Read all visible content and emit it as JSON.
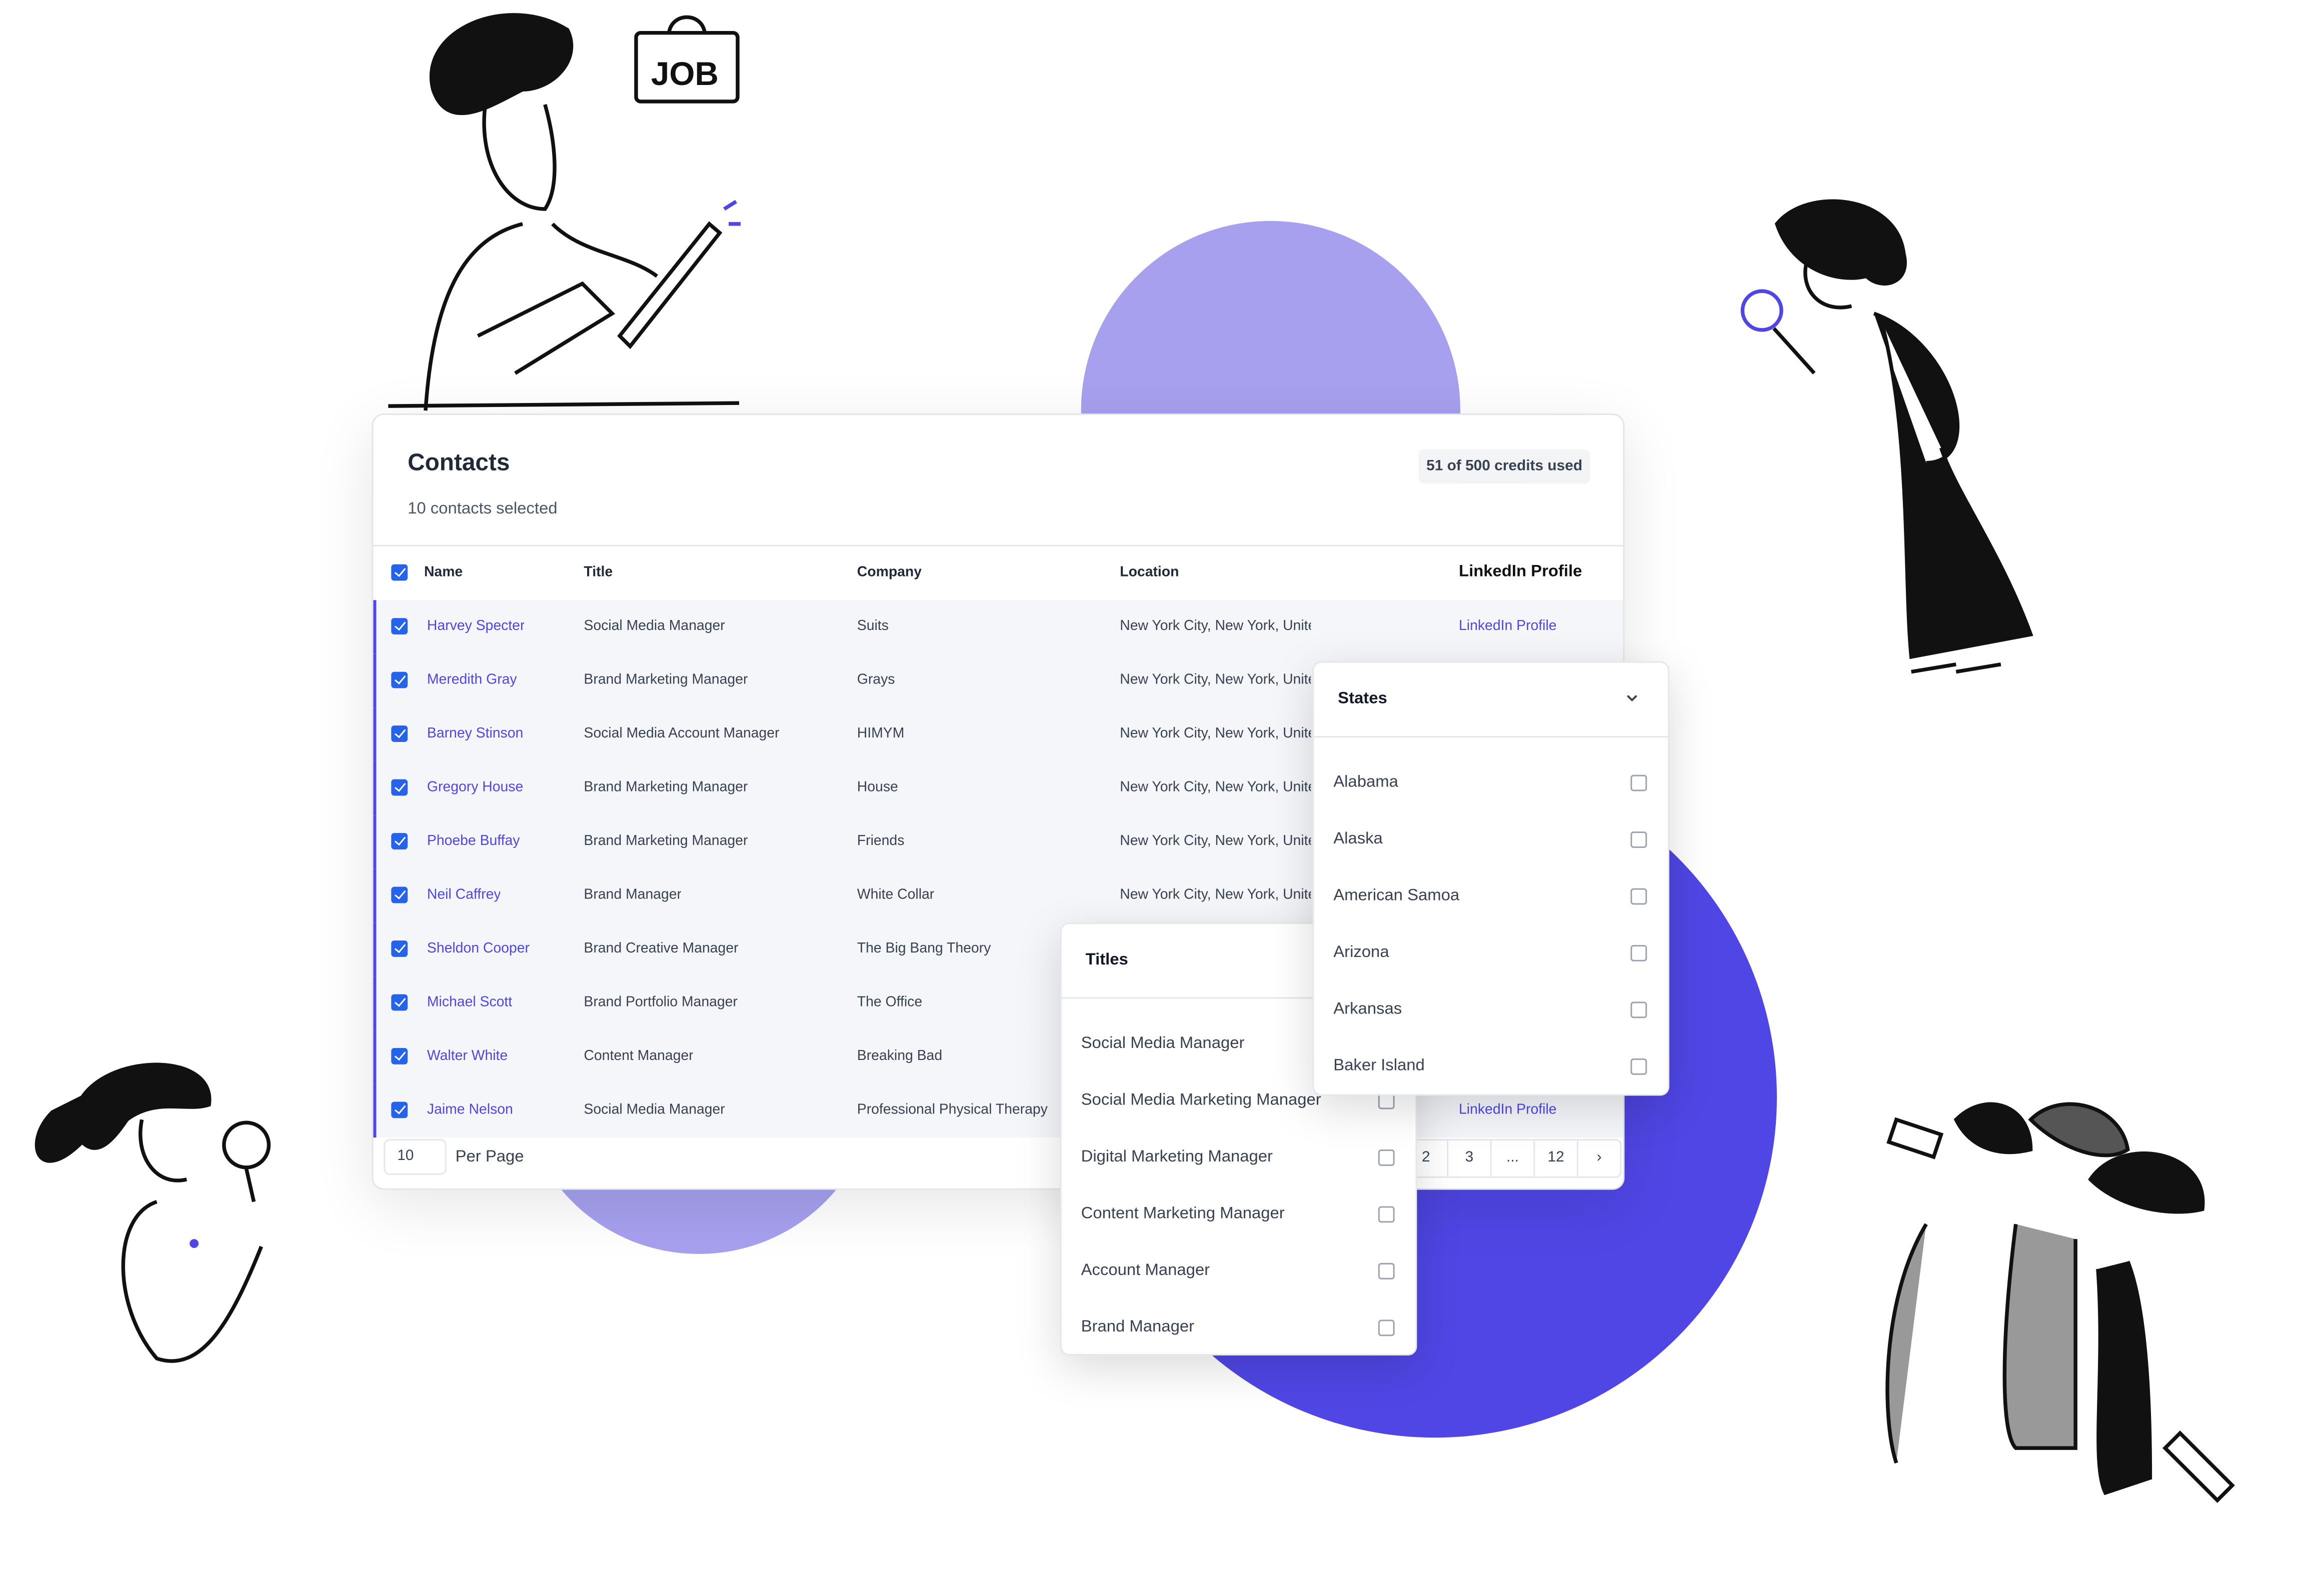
{
  "colors": {
    "accent": "#4f46e5",
    "accent_light": "#a6a0ef",
    "row_bg": "#f5f6fa"
  },
  "contacts": {
    "title": "Contacts",
    "subtitle": "10 contacts selected",
    "credits_badge": "51 of 500 credits used",
    "columns": [
      "Name",
      "Title",
      "Company",
      "Location",
      "LinkedIn Profile"
    ],
    "rows": [
      {
        "name": "Harvey Specter",
        "title": "Social Media Manager",
        "company": "Suits",
        "location": "New York City, New York, United States",
        "linkedin": "LinkedIn Profile"
      },
      {
        "name": "Meredith Gray",
        "title": "Brand Marketing Manager",
        "company": "Grays",
        "location": "New York City, New York, United States",
        "linkedin": ""
      },
      {
        "name": "Barney Stinson",
        "title": "Social Media Account Manager",
        "company": "HIMYM",
        "location": "New York City, New York, United States",
        "linkedin": ""
      },
      {
        "name": "Gregory House",
        "title": "Brand Marketing Manager",
        "company": "House",
        "location": "New York City, New York, United States",
        "linkedin": ""
      },
      {
        "name": "Phoebe Buffay",
        "title": "Brand Marketing Manager",
        "company": "Friends",
        "location": "New York City, New York, United States",
        "linkedin": ""
      },
      {
        "name": "Neil Caffrey",
        "title": "Brand Manager",
        "company": "White Collar",
        "location": "New York City, New York, United States",
        "linkedin": ""
      },
      {
        "name": "Sheldon Cooper",
        "title": "Brand Creative Manager",
        "company": "The Big Bang Theory",
        "location": "",
        "linkedin": ""
      },
      {
        "name": "Michael Scott",
        "title": "Brand Portfolio Manager",
        "company": "The Office",
        "location": "",
        "linkedin": ""
      },
      {
        "name": "Walter White",
        "title": "Content Manager",
        "company": "Breaking Bad",
        "location": "",
        "linkedin": ""
      },
      {
        "name": "Jaime Nelson",
        "title": "Social Media Manager",
        "company": "Professional Physical Therapy",
        "location": "",
        "linkedin": "LinkedIn Profile"
      }
    ],
    "per_page_value": "10",
    "per_page_label": "Per Page",
    "pagination": [
      "2",
      "3",
      "...",
      "12",
      "›"
    ]
  },
  "titles_panel": {
    "header": "Titles",
    "items": [
      "Social Media Manager",
      "Social Media Marketing Manager",
      "Digital Marketing Manager",
      "Content Marketing Manager",
      "Account Manager",
      "Brand Manager"
    ]
  },
  "states_panel": {
    "header": "States",
    "items": [
      "Alabama",
      "Alaska",
      "American Samoa",
      "Arizona",
      "Arkansas",
      "Baker Island"
    ]
  },
  "illustrations": {
    "job_sign": "JOB"
  }
}
